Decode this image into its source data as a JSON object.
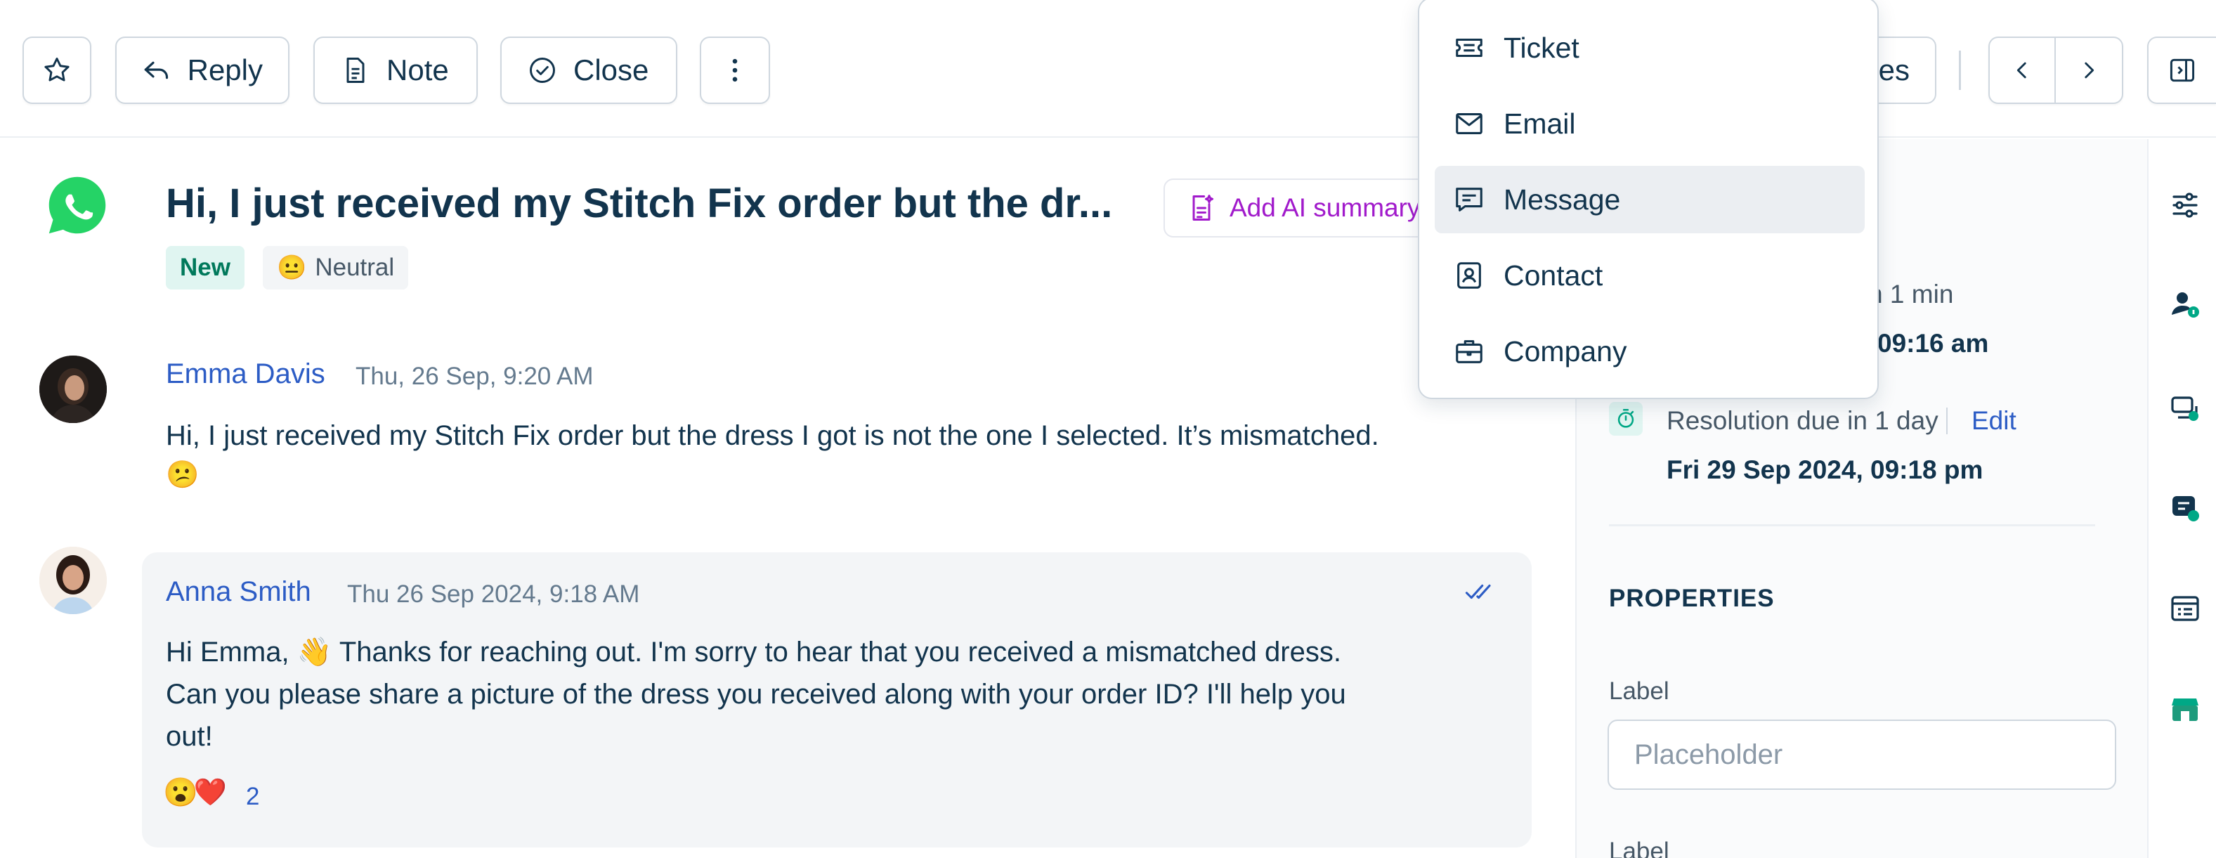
{
  "toolbar": {
    "reply_label": "Reply",
    "note_label": "Note",
    "close_label": "Close",
    "partial_label": "es"
  },
  "ticket": {
    "title": "Hi, I just received my Stitch Fix order but the dr...",
    "ai_summary_label": "Add AI summary",
    "status_badge": "New",
    "sentiment_emoji": "😐",
    "sentiment_label": "Neutral"
  },
  "messages": [
    {
      "author": "Emma Davis",
      "time": "Thu, 26 Sep, 9:20 AM",
      "text": "Hi, I just received my Stitch Fix order but the dress I got is not the one I selected. It’s mismatched.",
      "emoji": "😕"
    },
    {
      "author": "Anna Smith",
      "time": "Thu 26 Sep 2024, 9:18 AM",
      "text_line1": "Hi Emma, 👋 Thanks for reaching out. I'm sorry to hear that you received a mismatched dress.",
      "text_line2": "Can you please share a picture of the dress you received along with your order ID? I'll help you",
      "text_line3": "out!",
      "reactions": [
        "😮",
        "❤️"
      ],
      "reaction_count": "2"
    }
  ],
  "sidebar": {
    "first_response_partial": "e in 1 min",
    "first_response_date_partial": "09:16 am",
    "resolution_label": "Resolution due in 1 day",
    "resolution_edit": "Edit",
    "resolution_date": "Fri 29 Sep 2024, 09:18 pm",
    "properties_title": "PROPERTIES",
    "field1_label": "Label",
    "field1_placeholder": "Placeholder",
    "field2_label": "Label"
  },
  "dropdown": {
    "items": [
      "Ticket",
      "Email",
      "Message",
      "Contact",
      "Company"
    ],
    "active": "Message"
  },
  "colors": {
    "link_blue": "#2c5cc5",
    "ai_purple": "#a11acb",
    "whatsapp_green": "#25d366",
    "new_badge_bg": "#e0f5f1",
    "new_badge_text": "#00795b"
  }
}
